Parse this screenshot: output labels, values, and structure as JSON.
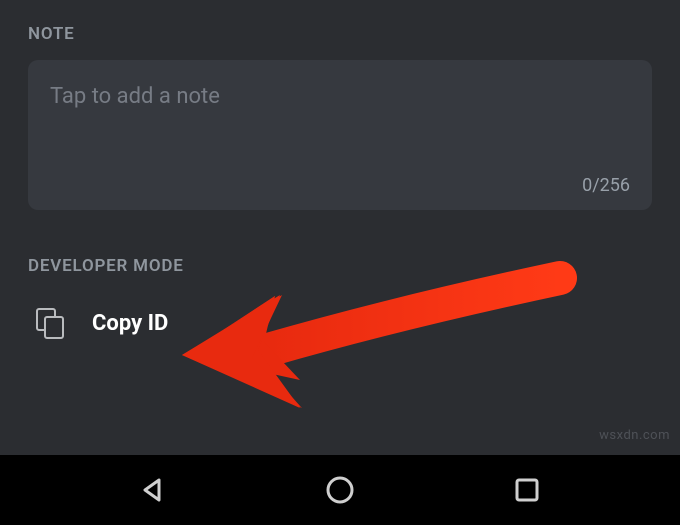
{
  "note": {
    "section_label": "NOTE",
    "placeholder": "Tap to add a note",
    "counter": "0/256"
  },
  "developer": {
    "section_label": "DEVELOPER MODE",
    "copy_id_label": "Copy ID"
  },
  "watermark": "wsxdn.com",
  "icons": {
    "copy": "copy-icon",
    "nav_back": "nav-back-icon",
    "nav_home": "nav-home-icon",
    "nav_recent": "nav-recent-icon"
  },
  "annotation": {
    "arrow_color": "#e82a0f"
  }
}
